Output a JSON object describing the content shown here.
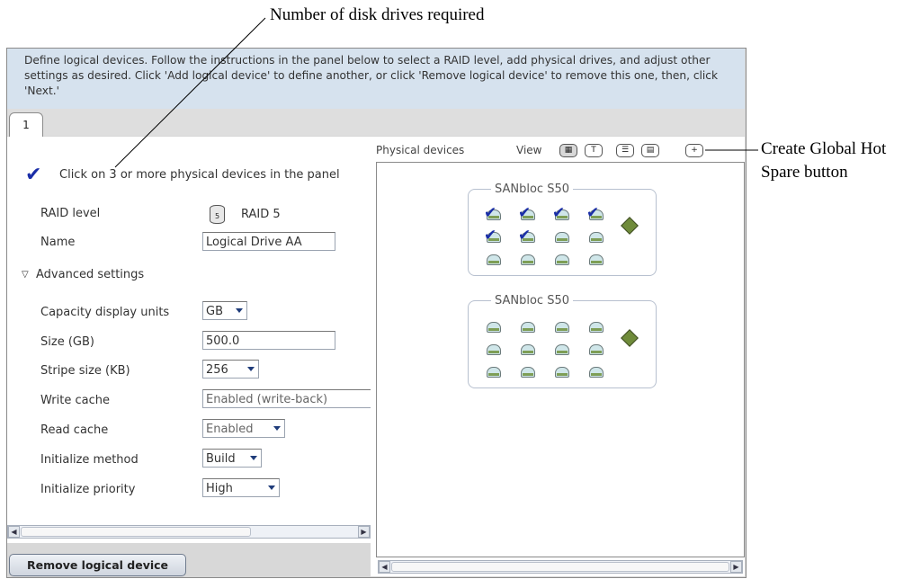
{
  "callouts": {
    "disk_drives": "Number of disk drives required",
    "hot_spare_line1": "Create Global Hot",
    "hot_spare_line2": "Spare button"
  },
  "instructions": "Define logical devices.  Follow the instructions in the panel below to select a RAID level, add physical drives, and adjust other settings as desired.  Click 'Add logical device' to define another, or click 'Remove logical device' to remove this one, then, click 'Next.'",
  "tab": {
    "label": "1"
  },
  "left_panel": {
    "hint": "Click on 3 or more physical devices in the panel",
    "raid_label": "RAID level",
    "raid_value": "RAID 5",
    "name_label": "Name",
    "name_value": "Logical Drive AA",
    "advanced": "Advanced settings",
    "settings": {
      "capacity_units_label": "Capacity display units",
      "capacity_units_value": "GB",
      "size_label": "Size (GB)",
      "size_value": "500.0",
      "stripe_label": "Stripe size (KB)",
      "stripe_value": "256",
      "write_cache_label": "Write cache",
      "write_cache_value": "Enabled (write-back)",
      "read_cache_label": "Read cache",
      "read_cache_value": "Enabled",
      "init_method_label": "Initialize method",
      "init_method_value": "Build",
      "init_priority_label": "Initialize priority",
      "init_priority_value": "High"
    }
  },
  "right_panel": {
    "title": "Physical devices",
    "view_label": "View",
    "enclosures": [
      {
        "title": "SANbloc S50",
        "selected_disks": 6,
        "total_disks": 12
      },
      {
        "title": "SANbloc S50",
        "selected_disks": 0,
        "total_disks": 12
      }
    ]
  },
  "buttons": {
    "remove": "Remove logical device"
  },
  "colors": {
    "instructions_bg": "#d6e2ee",
    "check": "#1a2ea8",
    "disk": "#cfe6e9"
  }
}
